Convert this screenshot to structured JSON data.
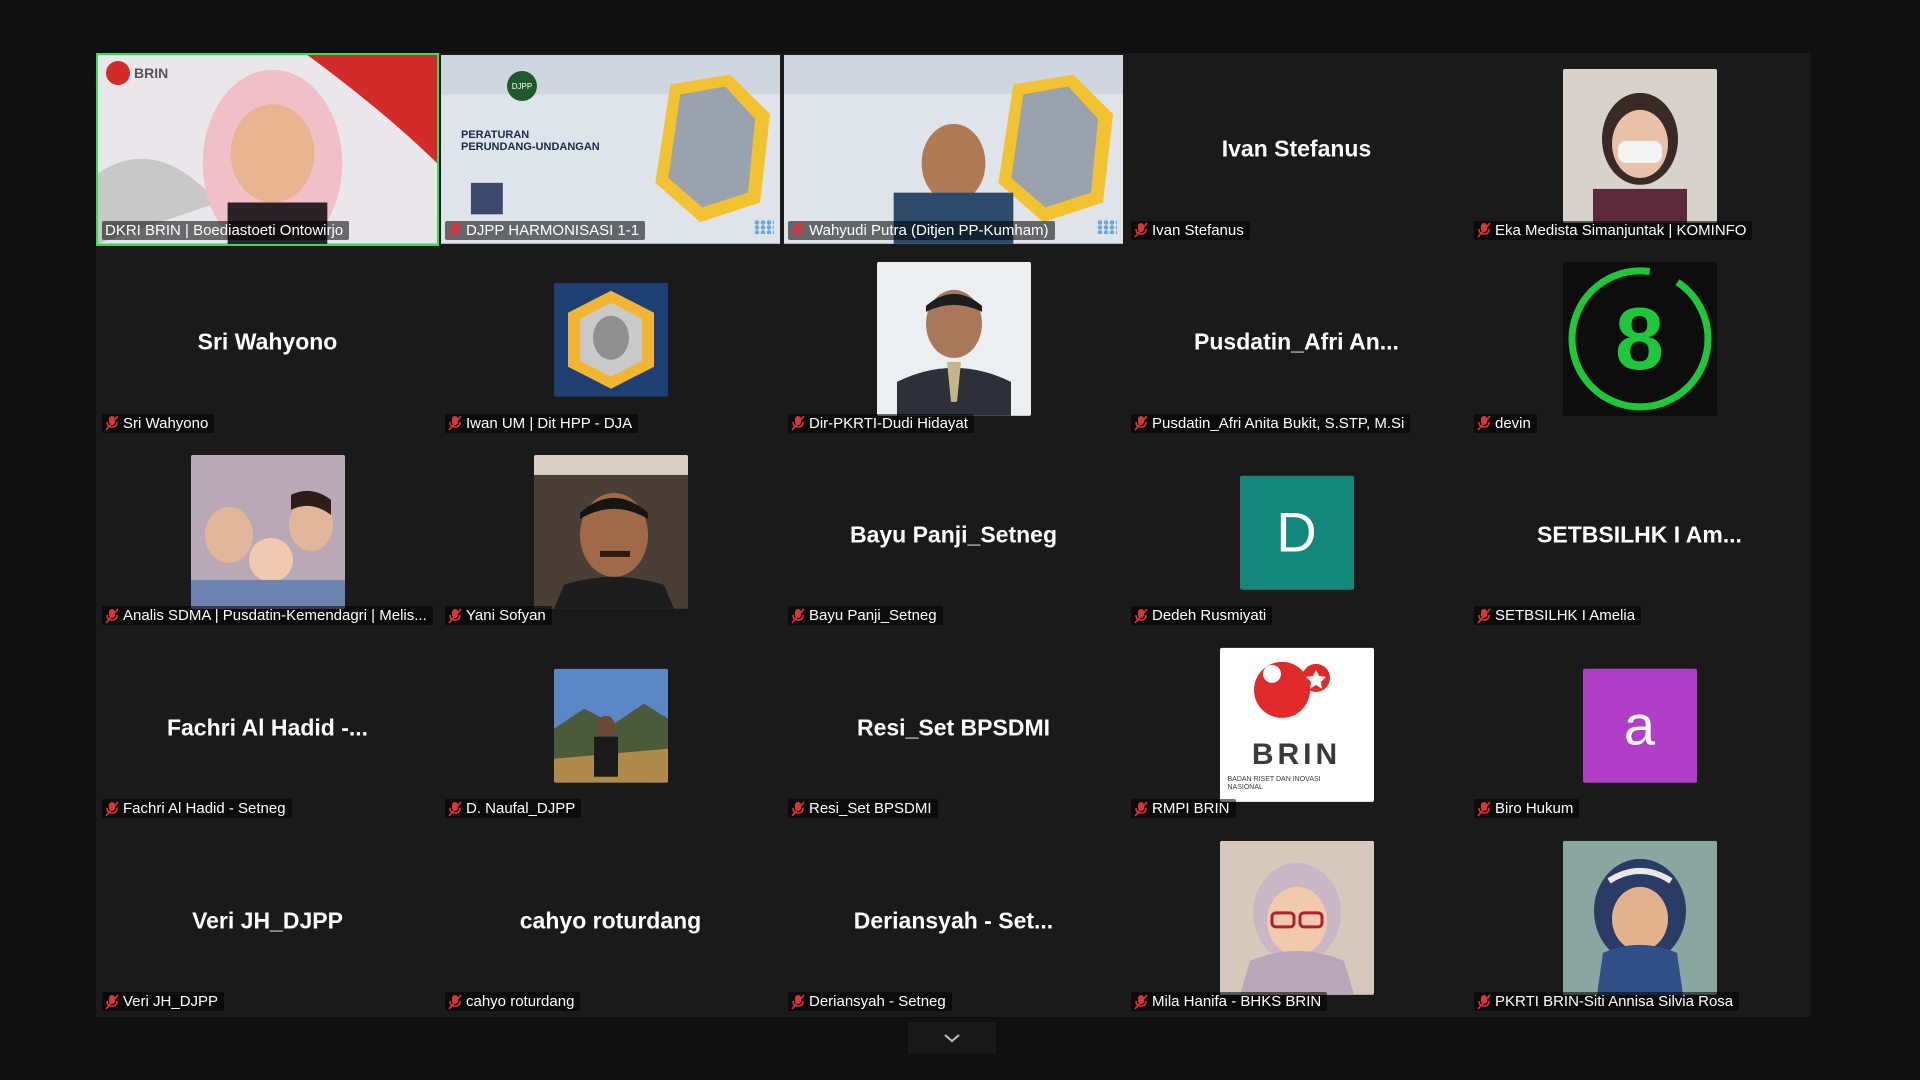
{
  "participants": [
    {
      "label": "DKRI BRIN | Boediastoeti Ontowirjo",
      "active": true
    },
    {
      "label": "DJPP HARMONISASI 1-1"
    },
    {
      "label": "Wahyudi Putra (Ditjen PP-Kumham)"
    },
    {
      "label": "Ivan Stefanus",
      "center_name": "Ivan Stefanus"
    },
    {
      "label": "Eka Medista Simanjuntak | KOMINFO"
    },
    {
      "label": "Sri Wahyono",
      "center_name": "Sri Wahyono"
    },
    {
      "label": "Iwan UM | Dit HPP - DJA"
    },
    {
      "label": "Dir-PKRTI-Dudi Hidayat"
    },
    {
      "label": "Pusdatin_Afri Anita Bukit, S.STP, M.Si",
      "center_name": "Pusdatin_Afri  An..."
    },
    {
      "label": "devin",
      "avatar_text": "8"
    },
    {
      "label": "Analis SDMA | Pusdatin-Kemendagri | Melis..."
    },
    {
      "label": "Yani Sofyan"
    },
    {
      "label": "Bayu Panji_Setneg",
      "center_name": "Bayu Panji_Setneg"
    },
    {
      "label": "Dedeh Rusmiyati",
      "avatar_letter": "D"
    },
    {
      "label": "SETBSILHK I Amelia",
      "center_name": "SETBSILHK I Am..."
    },
    {
      "label": "Fachri Al Hadid - Setneg",
      "center_name": "Fachri Al Hadid -..."
    },
    {
      "label": "D. Naufal_DJPP"
    },
    {
      "label": "Resi_Set BPSDMI",
      "center_name": "Resi_Set BPSDMI"
    },
    {
      "label": "RMPI BRIN",
      "logo_text": "BRIN",
      "logo_sub": "BADAN RISET DAN INOVASI NASIONAL"
    },
    {
      "label": "Biro Hukum",
      "avatar_letter": "a"
    },
    {
      "label": "Veri JH_DJPP",
      "center_name": "Veri JH_DJPP"
    },
    {
      "label": "cahyo roturdang",
      "center_name": "cahyo roturdang"
    },
    {
      "label": "Deriansyah - Setneg",
      "center_name": "Deriansyah - Set..."
    },
    {
      "label": "Mila Hanifa - BHKS BRIN"
    },
    {
      "label": "PKRTI BRIN-Siti Annisa Silvia Rosa"
    }
  ],
  "brin_overlay": {
    "brand": "BRIN"
  },
  "slide": {
    "heading_line1": "PERATURAN",
    "heading_line2": "PERUNDANG-UNDANGAN",
    "badge": "DJPP"
  },
  "colors": {
    "active_border": "#2ee24f",
    "mute": "#e0323a",
    "letter_D": "#12877a",
    "letter_a": "#b13ec7",
    "devin_ring": "#1ec83a"
  },
  "icons": {
    "mute": "microphone-muted-icon",
    "scroll": "chevron-down-icon"
  }
}
